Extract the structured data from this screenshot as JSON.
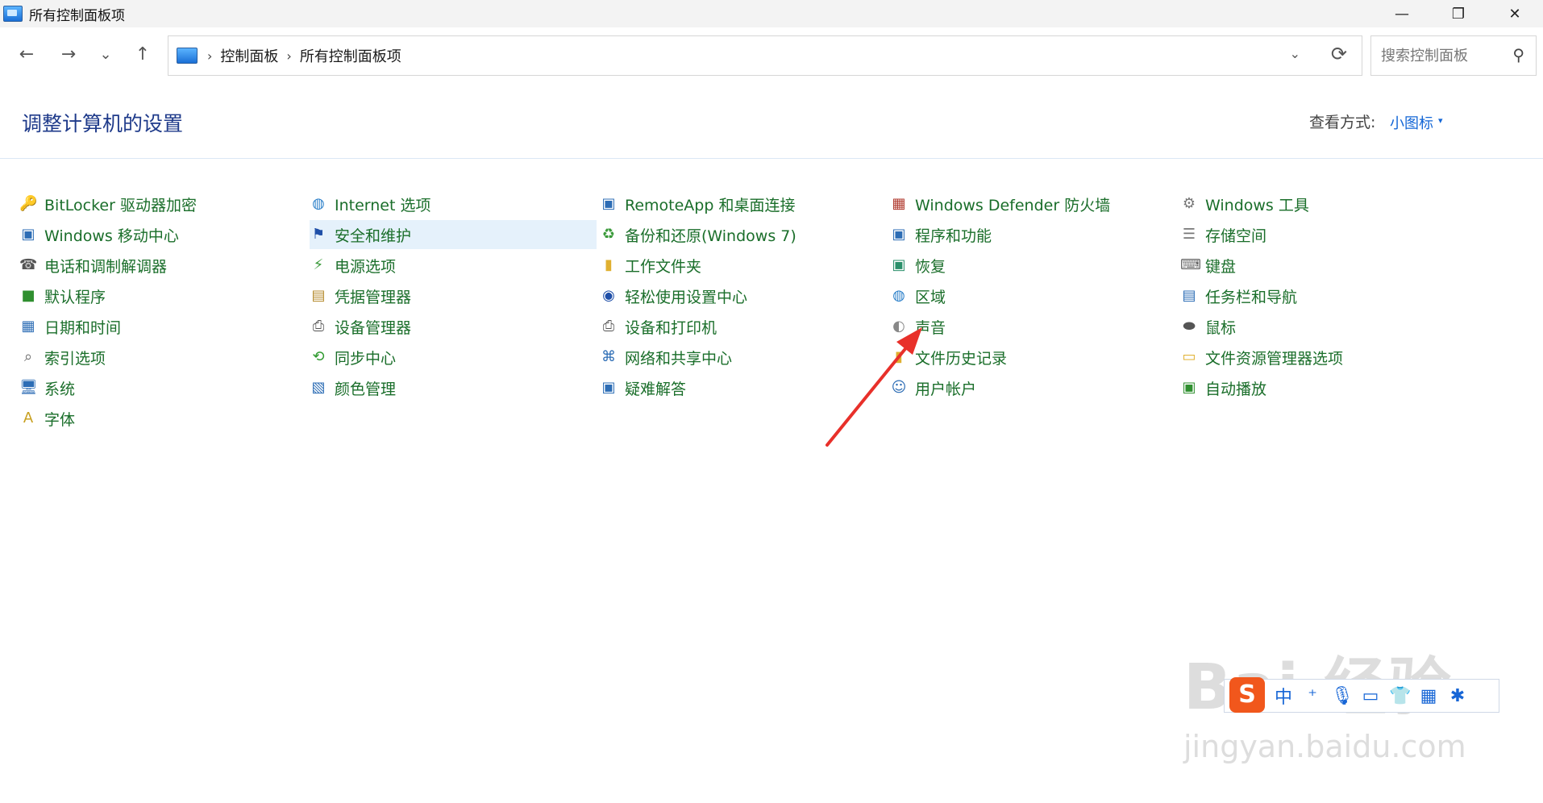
{
  "window": {
    "title": "所有控制面板项",
    "minimize": "—",
    "restore": "❐",
    "close": "✕"
  },
  "nav": {
    "back": "←",
    "forward": "→",
    "recent": "⌄",
    "up": "↑",
    "breadcrumb_sep": "›",
    "breadcrumb": [
      "控制面板",
      "所有控制面板项"
    ],
    "address_dropdown": "⌄",
    "refresh": "⟳"
  },
  "search": {
    "placeholder": "搜索控制面板",
    "icon": "⚲"
  },
  "header": {
    "title": "调整计算机的设置",
    "view_label": "查看方式:",
    "view_value": "小图标",
    "view_caret": "▾"
  },
  "items": {
    "c1": [
      {
        "label": "BitLocker 驱动器加密",
        "icon": "bitlocker-icon",
        "glyph": "🔑",
        "color": "#b48a2c"
      },
      {
        "label": "Windows 移动中心",
        "icon": "mobility-center-icon",
        "glyph": "▣",
        "color": "#2d6db5"
      },
      {
        "label": "电话和调制解调器",
        "icon": "phone-modem-icon",
        "glyph": "☎",
        "color": "#555555"
      },
      {
        "label": "默认程序",
        "icon": "default-programs-icon",
        "glyph": "■",
        "color": "#2f8f2f"
      },
      {
        "label": "日期和时间",
        "icon": "date-time-icon",
        "glyph": "▦",
        "color": "#2d6db5"
      },
      {
        "label": "索引选项",
        "icon": "indexing-icon",
        "glyph": "⌕",
        "color": "#666666"
      },
      {
        "label": "系统",
        "icon": "system-icon",
        "glyph": "🖥",
        "color": "#2d6db5"
      },
      {
        "label": "字体",
        "icon": "fonts-icon",
        "glyph": "A",
        "color": "#c8a020"
      }
    ],
    "c2": [
      {
        "label": "Internet 选项",
        "icon": "internet-options-icon",
        "glyph": "◍",
        "color": "#2a7fc9"
      },
      {
        "label": "安全和维护",
        "icon": "security-maintenance-icon",
        "glyph": "⚑",
        "color": "#1f4fa8"
      },
      {
        "label": "电源选项",
        "icon": "power-options-icon",
        "glyph": "⚡",
        "color": "#3a9a3a"
      },
      {
        "label": "凭据管理器",
        "icon": "credential-manager-icon",
        "glyph": "▤",
        "color": "#b48a2c"
      },
      {
        "label": "设备管理器",
        "icon": "device-manager-icon",
        "glyph": "⎙",
        "color": "#555555"
      },
      {
        "label": "同步中心",
        "icon": "sync-center-icon",
        "glyph": "⟲",
        "color": "#2f9a2f"
      },
      {
        "label": "颜色管理",
        "icon": "color-management-icon",
        "glyph": "▧",
        "color": "#2d6db5"
      }
    ],
    "c3": [
      {
        "label": "RemoteApp 和桌面连接",
        "icon": "remoteapp-icon",
        "glyph": "▣",
        "color": "#2d6db5"
      },
      {
        "label": "备份和还原(Windows 7)",
        "icon": "backup-restore-icon",
        "glyph": "♻",
        "color": "#3a9a3a"
      },
      {
        "label": "工作文件夹",
        "icon": "work-folders-icon",
        "glyph": "▮",
        "color": "#e0b030"
      },
      {
        "label": "轻松使用设置中心",
        "icon": "ease-of-access-icon",
        "glyph": "◉",
        "color": "#1f4fa8"
      },
      {
        "label": "设备和打印机",
        "icon": "devices-printers-icon",
        "glyph": "⎙",
        "color": "#555555"
      },
      {
        "label": "网络和共享中心",
        "icon": "network-sharing-icon",
        "glyph": "⌘",
        "color": "#2d6db5"
      },
      {
        "label": "疑难解答",
        "icon": "troubleshooting-icon",
        "glyph": "▣",
        "color": "#2d6db5"
      }
    ],
    "c4": [
      {
        "label": "Windows Defender 防火墙",
        "icon": "firewall-icon",
        "glyph": "▦",
        "color": "#b03a2e"
      },
      {
        "label": "程序和功能",
        "icon": "programs-features-icon",
        "glyph": "▣",
        "color": "#2d6db5"
      },
      {
        "label": "恢复",
        "icon": "recovery-icon",
        "glyph": "▣",
        "color": "#2a8f6a"
      },
      {
        "label": "区域",
        "icon": "region-icon",
        "glyph": "◍",
        "color": "#2a7fc9"
      },
      {
        "label": "声音",
        "icon": "sound-icon",
        "glyph": "◐",
        "color": "#888888"
      },
      {
        "label": "文件历史记录",
        "icon": "file-history-icon",
        "glyph": "▮",
        "color": "#e0b030"
      },
      {
        "label": "用户帐户",
        "icon": "user-accounts-icon",
        "glyph": "☺",
        "color": "#2d6db5"
      }
    ],
    "c5": [
      {
        "label": "Windows 工具",
        "icon": "windows-tools-icon",
        "glyph": "⚙",
        "color": "#777777"
      },
      {
        "label": "存储空间",
        "icon": "storage-spaces-icon",
        "glyph": "☰",
        "color": "#777777"
      },
      {
        "label": "键盘",
        "icon": "keyboard-icon",
        "glyph": "⌨",
        "color": "#666666"
      },
      {
        "label": "任务栏和导航",
        "icon": "taskbar-navigation-icon",
        "glyph": "▤",
        "color": "#2d6db5"
      },
      {
        "label": "鼠标",
        "icon": "mouse-icon",
        "glyph": "⬬",
        "color": "#555555"
      },
      {
        "label": "文件资源管理器选项",
        "icon": "file-explorer-options-icon",
        "glyph": "▭",
        "color": "#e0b030"
      },
      {
        "label": "自动播放",
        "icon": "autoplay-icon",
        "glyph": "▣",
        "color": "#2f8f2f"
      }
    ]
  },
  "ime": {
    "logo": "S",
    "buttons": [
      "中",
      "⁺",
      "🎙",
      "▭",
      "👕",
      "▦",
      "✱"
    ]
  },
  "watermark": {
    "line1": "Bai 经验",
    "line2": "jingyan.baidu.com"
  },
  "accent": "#1366d6",
  "link_color": "#1a6e2a",
  "selected_bg": "#e5f1fb",
  "annotation_arrow_color": "#e8302a"
}
